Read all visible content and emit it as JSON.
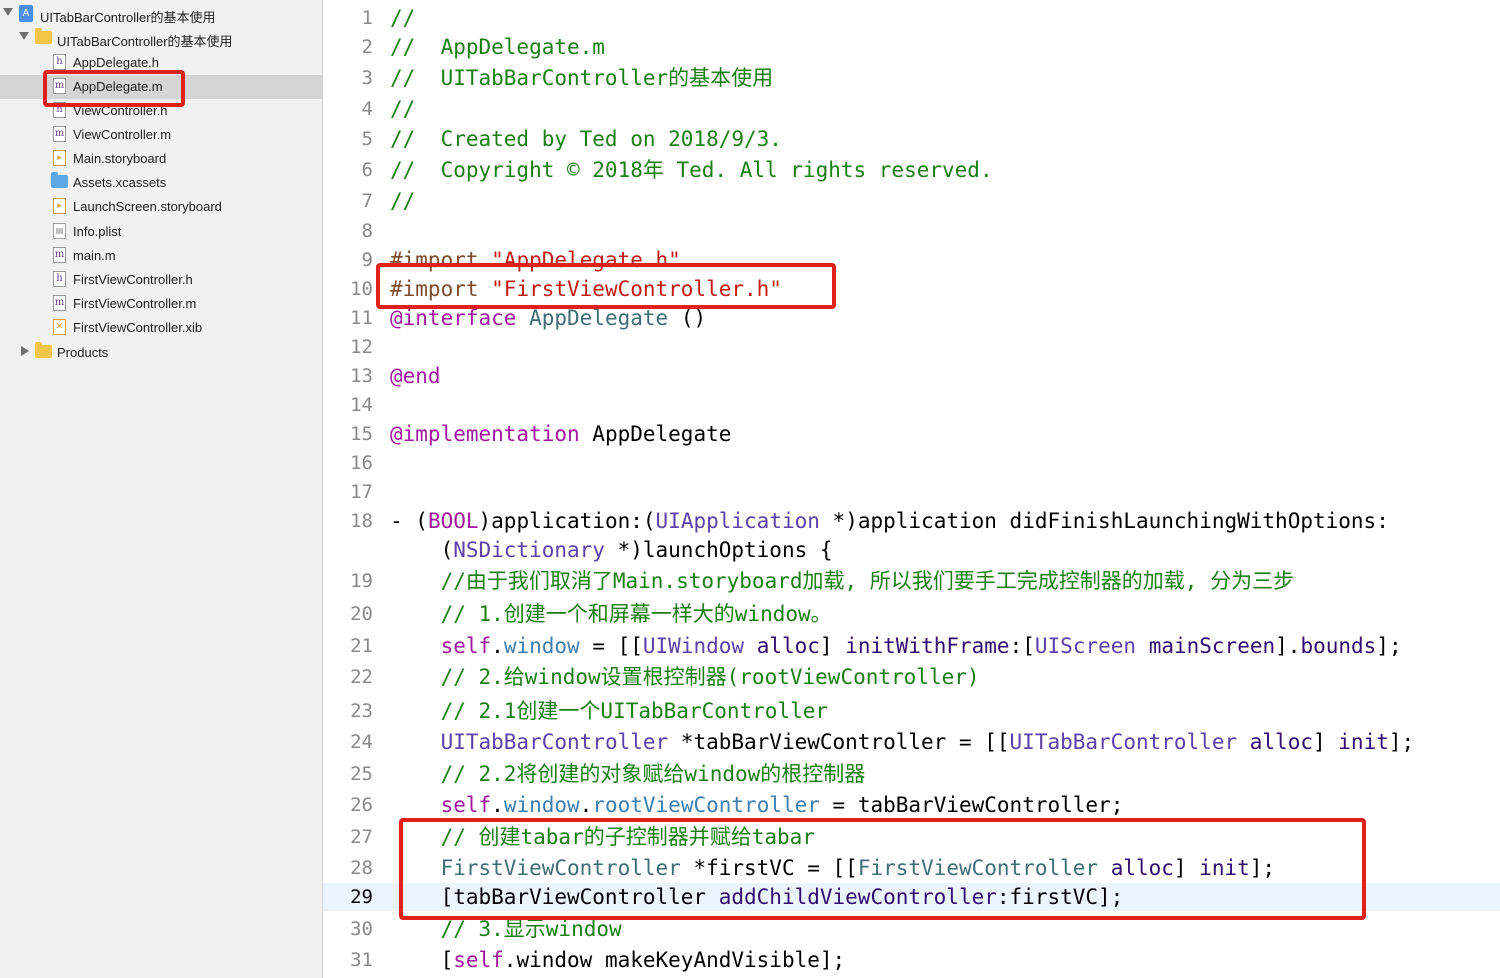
{
  "navigator": {
    "items": [
      {
        "label": "UITabBarController的基本使用",
        "kind": "project",
        "icon": "xcode-project-icon",
        "indent": 0,
        "disclosure": "open"
      },
      {
        "label": "UITabBarController的基本使用",
        "kind": "folder",
        "icon": "folder-icon",
        "indent": 1,
        "disclosure": "open"
      },
      {
        "label": "AppDelegate.h",
        "kind": "file",
        "icon": "header-file-icon",
        "glyph": "h"
      },
      {
        "label": "AppDelegate.m",
        "kind": "file",
        "icon": "objc-file-icon",
        "glyph": "m",
        "selected": true
      },
      {
        "label": "ViewController.h",
        "kind": "file",
        "icon": "header-file-icon",
        "glyph": "h"
      },
      {
        "label": "ViewController.m",
        "kind": "file",
        "icon": "objc-file-icon",
        "glyph": "m"
      },
      {
        "label": "Main.storyboard",
        "kind": "file",
        "icon": "storyboard-file-icon",
        "glyph": "sb"
      },
      {
        "label": "Assets.xcassets",
        "kind": "file",
        "icon": "asset-catalog-icon",
        "glyph": "folder"
      },
      {
        "label": "LaunchScreen.storyboard",
        "kind": "file",
        "icon": "storyboard-file-icon",
        "glyph": "sb"
      },
      {
        "label": "Info.plist",
        "kind": "file",
        "icon": "plist-file-icon",
        "glyph": "plist"
      },
      {
        "label": "main.m",
        "kind": "file",
        "icon": "objc-file-icon",
        "glyph": "m"
      },
      {
        "label": "FirstViewController.h",
        "kind": "file",
        "icon": "header-file-icon",
        "glyph": "h"
      },
      {
        "label": "FirstViewController.m",
        "kind": "file",
        "icon": "objc-file-icon",
        "glyph": "m"
      },
      {
        "label": "FirstViewController.xib",
        "kind": "file",
        "icon": "xib-file-icon",
        "glyph": "xib"
      },
      {
        "label": "Products",
        "kind": "folder",
        "icon": "folder-icon",
        "indent": 0,
        "disclosure": "closed"
      }
    ]
  },
  "editor": {
    "current_line": "29",
    "lines": [
      {
        "n": "1",
        "tokens": [
          [
            "cmt",
            "//"
          ]
        ]
      },
      {
        "n": "2",
        "tokens": [
          [
            "cmt",
            "//  AppDelegate.m"
          ]
        ]
      },
      {
        "n": "3",
        "tokens": [
          [
            "cmt",
            "//  UITabBarController的基本使用"
          ]
        ]
      },
      {
        "n": "4",
        "tokens": [
          [
            "cmt",
            "//"
          ]
        ]
      },
      {
        "n": "5",
        "tokens": [
          [
            "cmt",
            "//  Created by Ted on 2018/9/3."
          ]
        ]
      },
      {
        "n": "6",
        "tokens": [
          [
            "cmt",
            "//  Copyright © 2018年 Ted. All rights reserved."
          ]
        ]
      },
      {
        "n": "7",
        "tokens": [
          [
            "cmt",
            "//"
          ]
        ]
      },
      {
        "n": "8",
        "tokens": []
      },
      {
        "n": "9",
        "tokens": [
          [
            "pre",
            "#import "
          ],
          [
            "str",
            "\"AppDelegate.h\""
          ]
        ]
      },
      {
        "n": "10",
        "tokens": [
          [
            "pre",
            "#import "
          ],
          [
            "str",
            "\"FirstViewController.h\""
          ]
        ]
      },
      {
        "n": "11",
        "tokens": [
          [
            "kw",
            "@interface"
          ],
          [
            "",
            " "
          ],
          [
            "cls",
            "AppDelegate"
          ],
          [
            "",
            " ()"
          ]
        ]
      },
      {
        "n": "12",
        "tokens": []
      },
      {
        "n": "13",
        "tokens": [
          [
            "kw",
            "@end"
          ]
        ]
      },
      {
        "n": "14",
        "tokens": []
      },
      {
        "n": "15",
        "tokens": [
          [
            "kw",
            "@implementation"
          ],
          [
            "",
            " AppDelegate"
          ]
        ]
      },
      {
        "n": "16",
        "tokens": []
      },
      {
        "n": "17",
        "tokens": []
      },
      {
        "n": "18",
        "tokens": [
          [
            "",
            "- ("
          ],
          [
            "kw",
            "BOOL"
          ],
          [
            "",
            ")application:("
          ],
          [
            "typ",
            "UIApplication"
          ],
          [
            "",
            " *)application didFinishLaunchingWithOptions:"
          ]
        ]
      },
      {
        "n": "",
        "tokens": [
          [
            "",
            "    ("
          ],
          [
            "typ",
            "NSDictionary"
          ],
          [
            "",
            " *)launchOptions {"
          ]
        ]
      },
      {
        "n": "19",
        "tokens": [
          [
            "",
            "    "
          ],
          [
            "cmt",
            "//由于我们取消了Main.storyboard加载, 所以我们要手工完成控制器的加载, 分为三步"
          ]
        ]
      },
      {
        "n": "20",
        "tokens": [
          [
            "",
            "    "
          ],
          [
            "cmt",
            "// 1.创建一个和屏幕一样大的window。"
          ]
        ]
      },
      {
        "n": "21",
        "tokens": [
          [
            "",
            "    "
          ],
          [
            "kw",
            "self"
          ],
          [
            "",
            "."
          ],
          [
            "prop",
            "window"
          ],
          [
            "",
            " = [["
          ],
          [
            "typ",
            "UIWindow"
          ],
          [
            "",
            " "
          ],
          [
            "meth",
            "alloc"
          ],
          [
            "",
            "] "
          ],
          [
            "meth",
            "initWithFrame"
          ],
          [
            "",
            ":["
          ],
          [
            "typ",
            "UIScreen"
          ],
          [
            "",
            " "
          ],
          [
            "meth",
            "mainScreen"
          ],
          [
            "",
            "]."
          ],
          [
            "meth",
            "bounds"
          ],
          [
            "",
            "];"
          ]
        ]
      },
      {
        "n": "22",
        "tokens": [
          [
            "",
            "    "
          ],
          [
            "cmt",
            "// 2.给window设置根控制器(rootViewController)"
          ]
        ]
      },
      {
        "n": "23",
        "tokens": [
          [
            "",
            "    "
          ],
          [
            "cmt",
            "// 2.1创建一个UITabBarController"
          ]
        ]
      },
      {
        "n": "24",
        "tokens": [
          [
            "",
            "    "
          ],
          [
            "typ",
            "UITabBarController"
          ],
          [
            "",
            " *tabBarViewController = [["
          ],
          [
            "typ",
            "UITabBarController"
          ],
          [
            "",
            " "
          ],
          [
            "meth",
            "alloc"
          ],
          [
            "",
            "] "
          ],
          [
            "meth",
            "init"
          ],
          [
            "",
            "];"
          ]
        ]
      },
      {
        "n": "25",
        "tokens": [
          [
            "",
            "    "
          ],
          [
            "cmt",
            "// 2.2将创建的对象赋给window的根控制器"
          ]
        ]
      },
      {
        "n": "26",
        "tokens": [
          [
            "",
            "    "
          ],
          [
            "kw",
            "self"
          ],
          [
            "",
            "."
          ],
          [
            "prop",
            "window"
          ],
          [
            "",
            "."
          ],
          [
            "prop",
            "rootViewController"
          ],
          [
            "",
            " = tabBarViewController;"
          ]
        ]
      },
      {
        "n": "27",
        "tokens": [
          [
            "",
            "    "
          ],
          [
            "cmt",
            "// 创建tabar的子控制器并赋给tabar"
          ]
        ]
      },
      {
        "n": "28",
        "tokens": [
          [
            "",
            "    "
          ],
          [
            "cls",
            "FirstViewController"
          ],
          [
            "",
            " *firstVC = [["
          ],
          [
            "cls",
            "FirstViewController"
          ],
          [
            "",
            " "
          ],
          [
            "meth",
            "alloc"
          ],
          [
            "",
            "] "
          ],
          [
            "meth",
            "init"
          ],
          [
            "",
            "];"
          ]
        ]
      },
      {
        "n": "29",
        "tokens": [
          [
            "",
            "    [tabBarViewController "
          ],
          [
            "meth",
            "addChildViewController"
          ],
          [
            "",
            ":firstVC];"
          ]
        ]
      },
      {
        "n": "30",
        "tokens": [
          [
            "",
            "    "
          ],
          [
            "cmt",
            "// 3.显示window"
          ]
        ]
      },
      {
        "n": "31",
        "tokens": [
          [
            "",
            "    ["
          ],
          [
            "kw",
            "self"
          ],
          [
            "",
            ".window makeKeyAndVisible];"
          ]
        ]
      }
    ]
  },
  "colors": {
    "comment": "#1c7f16",
    "string": "#c41a16",
    "keyword": "#a1169f",
    "annotation": "#e0201a"
  }
}
